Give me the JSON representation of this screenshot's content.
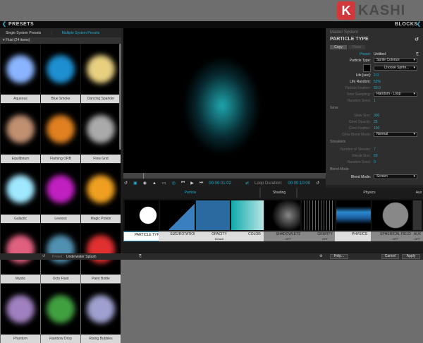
{
  "logo": {
    "letter": "K",
    "text": "KASHI"
  },
  "header": {
    "presets": "PRESETS",
    "blocks": "BLOCKS"
  },
  "presets": {
    "tabs": [
      "Single System Presets",
      "Multiple System Presets"
    ],
    "folder": "Fluid (24 items)",
    "items": [
      {
        "name": "Aqueous",
        "color": "#8ab4ff"
      },
      {
        "name": "Blue Smoke",
        "color": "#1e8fd0"
      },
      {
        "name": "Dancing Sparkler",
        "color": "#e8d080"
      },
      {
        "name": "Equilibrium",
        "color": "#c09070"
      },
      {
        "name": "Flaming ORB",
        "color": "#e08020"
      },
      {
        "name": "Flow Grid",
        "color": "#aaaaaa"
      },
      {
        "name": "Galactic",
        "color": "#9fe8ff"
      },
      {
        "name": "Levioso",
        "color": "#c020c0"
      },
      {
        "name": "Magic Potion",
        "color": "#f0a020"
      },
      {
        "name": "Mystic",
        "color": "#e06080"
      },
      {
        "name": "Octo Fluid",
        "color": "#5090b0"
      },
      {
        "name": "Paint Bottle",
        "color": "#e03030"
      },
      {
        "name": "Phantom",
        "color": "#a080c0"
      },
      {
        "name": "Rainbow Drop",
        "color": "#40a040"
      },
      {
        "name": "Rising Bubbles",
        "color": "#a0a0d0"
      }
    ]
  },
  "toolbar": {
    "timecode": "00:00:01:02",
    "loop_label": "Loop Duration:",
    "loop_value": "00:00:10:00"
  },
  "properties": {
    "system": "Master System",
    "title": "PARTICLE TYPE",
    "copy": "Copy",
    "paste": "Paste",
    "preset_label": "Preset:",
    "preset_value": "Untitled",
    "particle_type_label": "Particle Type:",
    "particle_type_value": "Sprite Colorize",
    "choose_sprite": "Choose Sprite...",
    "rows": [
      {
        "k": "Life [sec]:",
        "v": "2.0"
      },
      {
        "k": "Life Random:",
        "v": "52%"
      },
      {
        "k": "Particle Feather:",
        "v": "50.0",
        "dim": true
      }
    ],
    "time_sampling_label": "Time Sampling:",
    "time_sampling_value": "Random - Loop",
    "random_seed_label": "Random Seed:",
    "random_seed_value": "1",
    "glow": "Glow",
    "glow_rows": [
      {
        "k": "Glow Size:",
        "v": "300"
      },
      {
        "k": "Glow Opacity:",
        "v": "25"
      },
      {
        "k": "Glow Feather:",
        "v": "100"
      }
    ],
    "glow_blend_label": "Glow Blend Mode:",
    "glow_blend_value": "Normal",
    "streaklets": "Streaklets",
    "streak_rows": [
      {
        "k": "Number of Streaks:",
        "v": "7"
      },
      {
        "k": "Streak Size:",
        "v": "60"
      },
      {
        "k": "Random Seed:",
        "v": "0"
      }
    ],
    "blend_section": "Blend Mode",
    "blend_label": "Blend Mode:",
    "blend_value": "Screen"
  },
  "block_groups": [
    "Particle",
    "Shading",
    "Physics",
    "Aux"
  ],
  "blocks": [
    {
      "label": "PARTICLE TYPE",
      "sub": ""
    },
    {
      "label": "SIZE/ROTATION",
      "sub": ""
    },
    {
      "label": "OPACITY",
      "sub": "Default"
    },
    {
      "label": "COLOR",
      "sub": ""
    },
    {
      "label": "SHADOWLETS",
      "sub": "OFF"
    },
    {
      "label": "GRAVITY",
      "sub": "OFF"
    },
    {
      "label": "PHYSICS",
      "sub": ""
    },
    {
      "label": "SPHERICAL FIELD",
      "sub": "OFF"
    },
    {
      "label": "AUX",
      "sub": "OFF"
    }
  ],
  "footer": {
    "preset_label": "Preset:",
    "preset_value": "Underwater Splash",
    "help": "Help...",
    "cancel": "Cancel",
    "apply": "Apply"
  }
}
